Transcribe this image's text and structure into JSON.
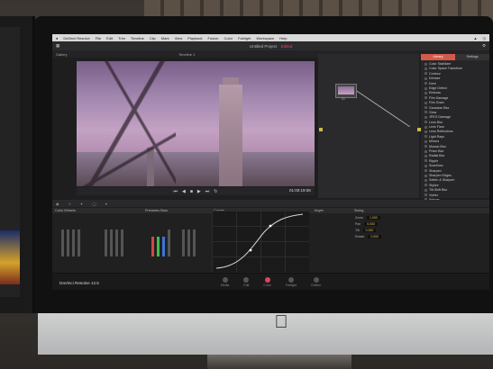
{
  "menubar": {
    "app": "DaVinci Resolve",
    "items": [
      "File",
      "Edit",
      "Trim",
      "Timeline",
      "Clip",
      "Mark",
      "View",
      "Playback",
      "Fusion",
      "Color",
      "Fairlight",
      "Workspace",
      "Help"
    ]
  },
  "header": {
    "project": "Untitled Project",
    "status": "Edited"
  },
  "subbar": {
    "left": "Gallery",
    "timeline": "Timeline 1"
  },
  "viewer": {
    "timecode": "01:00:19:08"
  },
  "nodes": {
    "node_label": "01"
  },
  "fx": {
    "tabs": [
      "Library",
      "Settings"
    ],
    "items": [
      "Color Stabilizer",
      "Color Space Transform",
      "Contour",
      "Dehaze",
      "Dent",
      "Edge Detect",
      "Emboss",
      "Film Damage",
      "Film Grain",
      "Gaussian Blur",
      "Glow",
      "JPEG Damage",
      "Lens Blur",
      "Lens Flare",
      "Lens Reflections",
      "Light Rays",
      "Mirrors",
      "Mosaic Blur",
      "Prism Blur",
      "Radial Blur",
      "Ripple",
      "Scanlines",
      "Sharpen",
      "Sharpen Edges",
      "Soften & Sharpen",
      "Stylize",
      "Tilt-Shift Blur",
      "Vortex",
      "Warper",
      "Watercolor",
      "Zoom Blur"
    ]
  },
  "panels": {
    "wheels": "Color Wheels",
    "primaries": "Primaries Bars",
    "curves": "Curves",
    "keyer": "Keyer",
    "sizing": "Sizing"
  },
  "sizing": {
    "rows": [
      {
        "label": "Zoom",
        "value": "1.000"
      },
      {
        "label": "Pan",
        "value": "0.000"
      },
      {
        "label": "Tilt",
        "value": "0.000"
      },
      {
        "label": "Rotate",
        "value": "0.000"
      }
    ]
  },
  "pages": [
    {
      "label": "Media",
      "active": false
    },
    {
      "label": "Edit",
      "active": false
    },
    {
      "label": "Color",
      "active": true
    },
    {
      "label": "Fairlight",
      "active": false
    },
    {
      "label": "Deliver",
      "active": false
    }
  ],
  "brand": "DaVinci Resolve 12.5",
  "colors": {
    "accent": "#d35a4a",
    "active_page": "#d34a5a"
  }
}
